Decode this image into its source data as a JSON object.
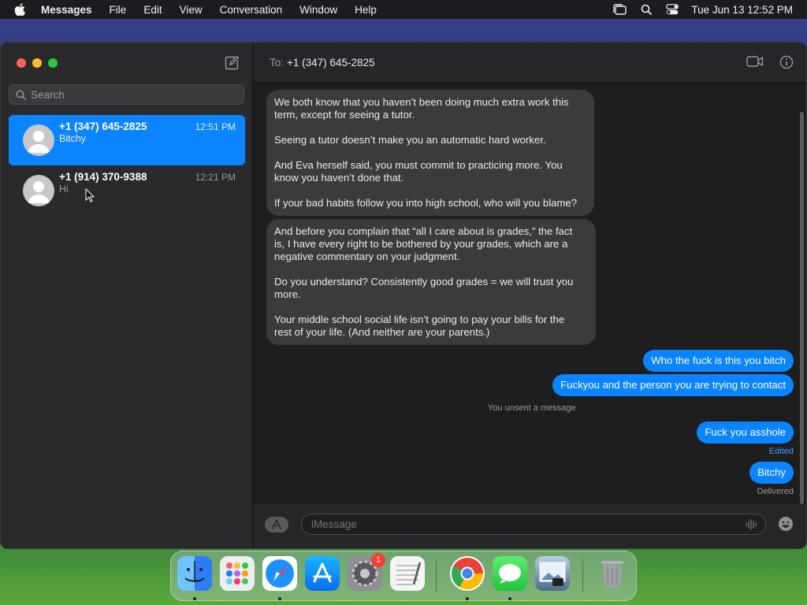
{
  "menubar": {
    "app_name": "Messages",
    "items": [
      "File",
      "Edit",
      "View",
      "Conversation",
      "Window",
      "Help"
    ],
    "clock": "Tue Jun 13  12:52 PM"
  },
  "sidebar": {
    "search_placeholder": "Search",
    "conversations": [
      {
        "name": "+1 (347) 645-2825",
        "preview": "Bitchy",
        "time": "12:51 PM",
        "selected": true
      },
      {
        "name": "+1 (914) 370-9388",
        "preview": "Hi",
        "time": "12:21 PM",
        "selected": false
      }
    ]
  },
  "header": {
    "to_label": "To:",
    "recipient": "+1 (347) 645-2825"
  },
  "messages": {
    "incoming_1": "We both know that you haven’t been doing much extra work this\nterm, except for seeing a tutor.\n\nSeeing a tutor doesn’t make you an automatic hard worker.\n\nAnd Eva herself said, you must commit to practicing more.  You\nknow you haven’t done that.\n\nIf your bad habits follow you into high school, who will you blame?",
    "incoming_2": "And before you complain that “all I care about is grades,” the fact\nis, I have every right to be bothered by your grades, which are a\nnegative commentary on your judgment.\n\nDo you understand?  Consistently good grades = we will trust you\nmore.\n\nYour middle school social life isn’t going to pay your bills for the\nrest of your life.  (And neither are your parents.)",
    "outgoing_1": "Who the fuck is this you bitch",
    "outgoing_2": "Fuckyou and the person you are trying to contact",
    "unsent_note": "You unsent a message",
    "outgoing_3": "Fuck you asshole",
    "edited_note": "Edited",
    "outgoing_4": "Bitchy",
    "delivered_note": "Delivered"
  },
  "composer": {
    "placeholder": "iMessage"
  },
  "dock": {
    "settings_badge": "1"
  },
  "colors": {
    "accent": "#0a84ff",
    "incoming_bubble": "#3b3b3d"
  }
}
